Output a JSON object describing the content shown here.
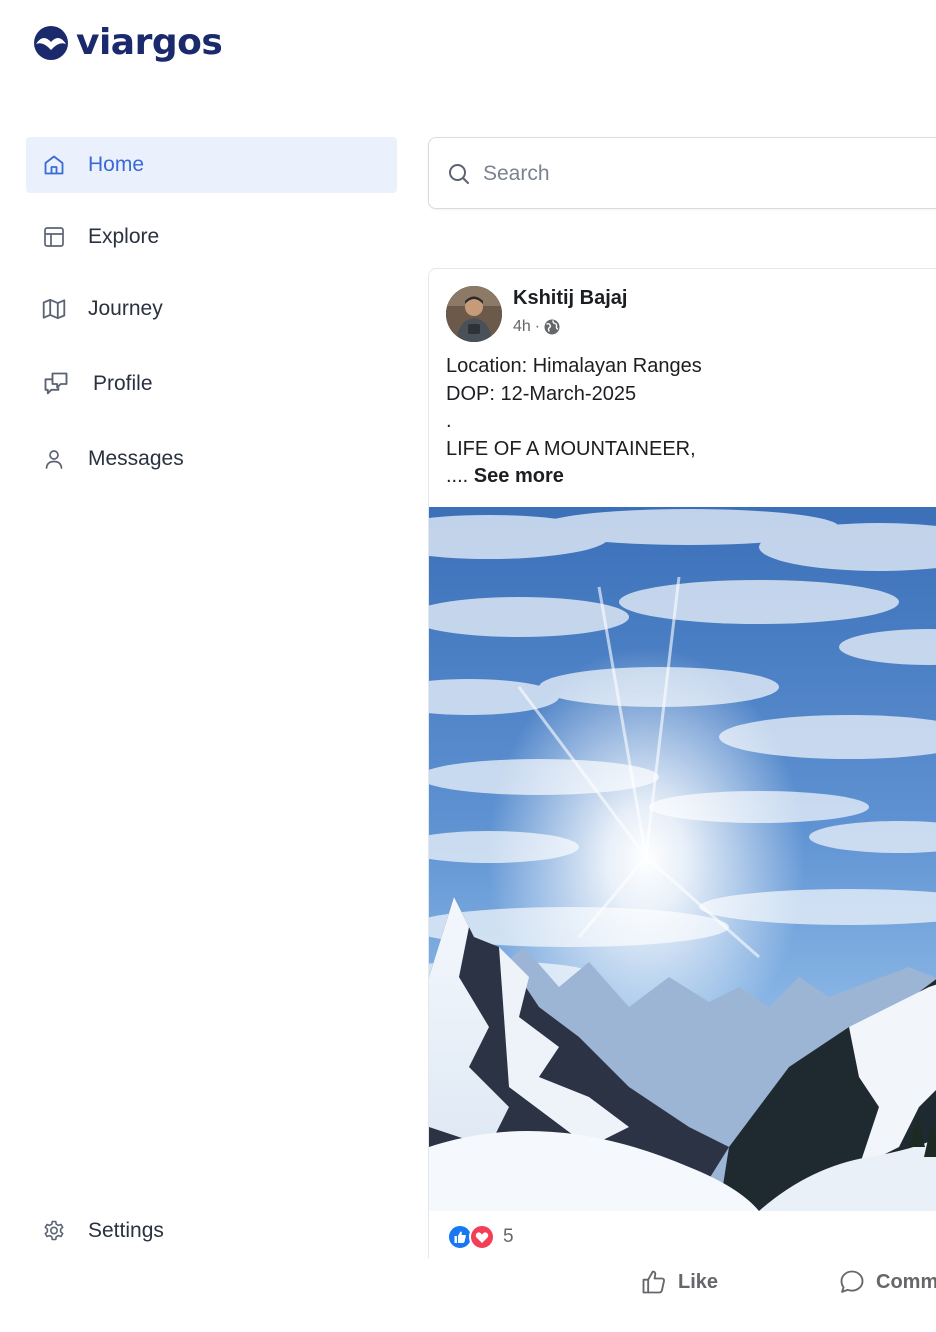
{
  "app": {
    "name": "viargos"
  },
  "sidebar": {
    "items": [
      {
        "label": "Home",
        "icon": "home-icon",
        "active": true
      },
      {
        "label": "Explore",
        "icon": "layout-icon"
      },
      {
        "label": "Journey",
        "icon": "map-icon"
      },
      {
        "label": "Profile",
        "icon": "chat-bubbles-icon"
      },
      {
        "label": "Messages",
        "icon": "user-icon"
      }
    ],
    "settings": {
      "label": "Settings",
      "icon": "gear-icon"
    }
  },
  "search": {
    "placeholder": "Search",
    "value": ""
  },
  "post": {
    "author": "Kshitij Bajaj",
    "time": "4h",
    "separator": "·",
    "visibility_icon": "globe-icon",
    "lines": [
      "Location: Himalayan Ranges",
      "DOP: 12-March-2025",
      ".",
      "LIFE OF A MOUNTAINEER,",
      "...."
    ],
    "see_more": "See more",
    "reactions": {
      "count": "5",
      "types": [
        "like-reaction-icon",
        "love-reaction-icon"
      ]
    },
    "actions": {
      "like": "Like",
      "comment": "Comm"
    }
  },
  "colors": {
    "brand": "#1a2a6c",
    "active_bg": "#eaf0fc",
    "active_text": "#3a6ad6",
    "like_blue": "#1877f2",
    "love_red": "#f33e58"
  }
}
